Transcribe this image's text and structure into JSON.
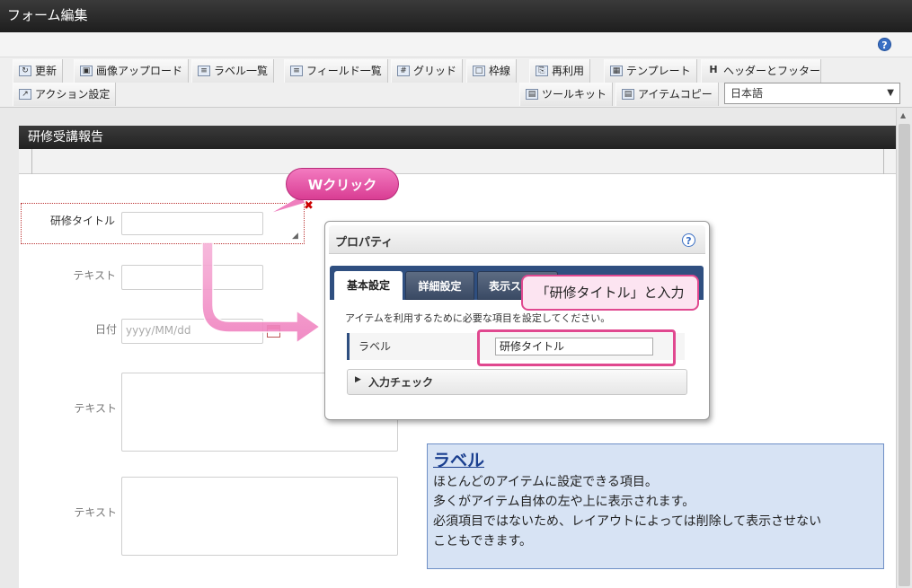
{
  "window": {
    "title": "フォーム編集"
  },
  "toolbar": {
    "row1": [
      {
        "label": "更新",
        "icon": "refresh-icon"
      },
      {
        "label": "画像アップロード",
        "icon": "image-upload-icon"
      },
      {
        "label": "ラベル一覧",
        "icon": "label-list-icon"
      },
      {
        "label": "フィールド一覧",
        "icon": "field-list-icon"
      },
      {
        "label": "グリッド",
        "icon": "grid-icon"
      },
      {
        "label": "枠線",
        "icon": "border-icon"
      },
      {
        "label": "再利用",
        "icon": "reuse-icon"
      },
      {
        "label": "テンプレート",
        "icon": "template-icon"
      },
      {
        "label": "ヘッダーとフッター",
        "icon": "header-footer-icon",
        "glyph": "H"
      }
    ],
    "row2_left": [
      {
        "label": "アクション設定",
        "icon": "action-settings-icon"
      }
    ],
    "row2_right": [
      {
        "label": "ツールキット",
        "icon": "toolkit-icon"
      },
      {
        "label": "アイテムコピー",
        "icon": "item-copy-icon"
      }
    ],
    "language": {
      "selected": "日本語"
    }
  },
  "form": {
    "title": "研修受講報告",
    "fields": [
      {
        "label": "研修タイトル"
      },
      {
        "label": "テキスト"
      },
      {
        "label": "日付",
        "placeholder": "yyyy/MM/dd"
      },
      {
        "label": "テキスト"
      },
      {
        "label": "テキスト"
      }
    ]
  },
  "callout_wclick": "Wクリック",
  "properties": {
    "title": "プロパティ",
    "tabs": [
      "基本設定",
      "詳細設定",
      "表示ス"
    ],
    "description": "アイテムを利用するために必要な項目を設定してください。",
    "label_row": {
      "name": "ラベル",
      "value": "研修タイトル"
    },
    "input_check": "入力チェック"
  },
  "callout_input": "「研修タイトル」と入力",
  "info": {
    "title": "ラベル",
    "lines": [
      "ほとんどのアイテムに設定できる項目。",
      "多くがアイテム自体の左や上に表示されます。",
      "必須項目ではないため、レイアウトによっては削除して表示させない",
      "こともできます。"
    ]
  }
}
